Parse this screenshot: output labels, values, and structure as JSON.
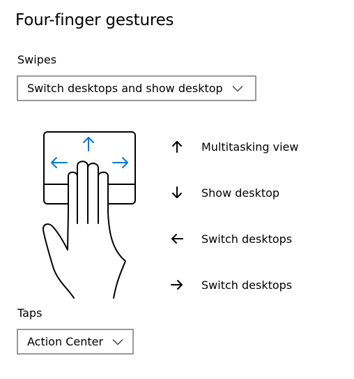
{
  "title": "Four-finger gestures",
  "swipes": {
    "label": "Swipes",
    "selected": "Switch desktops and show desktop"
  },
  "gestures": [
    {
      "direction": "up",
      "icon": "arrow-up-icon",
      "label": "Multitasking view"
    },
    {
      "direction": "down",
      "icon": "arrow-down-icon",
      "label": "Show desktop"
    },
    {
      "direction": "left",
      "icon": "arrow-left-icon",
      "label": "Switch desktops"
    },
    {
      "direction": "right",
      "icon": "arrow-right-icon",
      "label": "Switch desktops"
    }
  ],
  "taps": {
    "label": "Taps",
    "selected": "Action Center"
  },
  "colors": {
    "accent": "#0078d7",
    "border": "#999999",
    "text": "#000000"
  }
}
